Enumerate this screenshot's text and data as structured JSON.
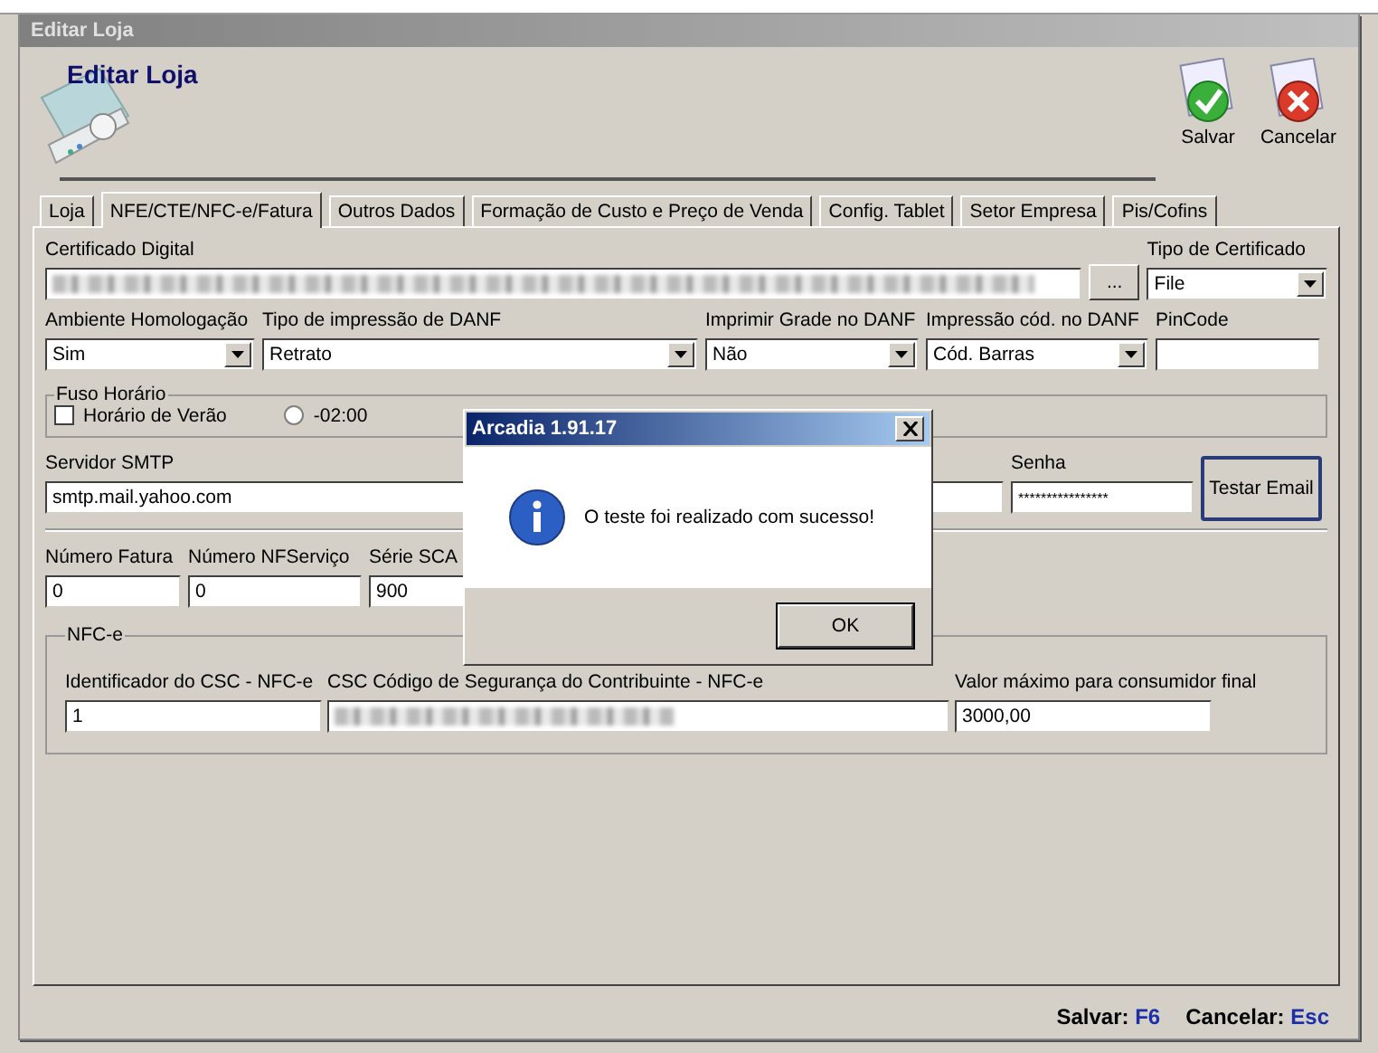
{
  "window": {
    "title": "Editar Loja"
  },
  "header": {
    "title": "Editar Loja"
  },
  "toolbar": [
    {
      "label": "Salvar",
      "kind": "save"
    },
    {
      "label": "Cancelar",
      "kind": "cancel"
    }
  ],
  "tabs": [
    {
      "label": "Loja",
      "selected": false
    },
    {
      "label": "NFE/CTE/NFC-e/Fatura",
      "selected": true
    },
    {
      "label": "Outros Dados",
      "selected": false
    },
    {
      "label": "Formação de Custo e Preço de Venda",
      "selected": false
    },
    {
      "label": "Config. Tablet",
      "selected": false
    },
    {
      "label": "Setor Empresa",
      "selected": false
    },
    {
      "label": "Pis/Cofins",
      "selected": false
    }
  ],
  "certificate": {
    "label": "Certificado Digital",
    "browse_button": "...",
    "type_label": "Tipo de Certificado",
    "type_value": "File"
  },
  "danf_row": [
    {
      "label": "Ambiente Homologação",
      "value": "Sim",
      "kind": "select"
    },
    {
      "label": "Tipo de impressão de DANF",
      "value": "Retrato",
      "kind": "select"
    },
    {
      "label": "Imprimir Grade no DANF",
      "value": "Não",
      "kind": "select"
    },
    {
      "label": "Impressão cód. no DANF",
      "value": "Cód. Barras",
      "kind": "select"
    },
    {
      "label": "PinCode",
      "kind": "text"
    }
  ],
  "timezone": {
    "legend": "Fuso Horário",
    "dst": {
      "label": "Horário de Verão",
      "checked": false
    },
    "offsets": [
      {
        "label": "-02:00",
        "selected": false
      }
    ]
  },
  "email": {
    "server_label": "Servidor SMTP",
    "server_value": "smtp.mail.yahoo.com",
    "password_label": "Senha",
    "password_value": "****************",
    "test_button": "Testar Email"
  },
  "numbers": [
    {
      "label": "Número Fatura",
      "value": "0"
    },
    {
      "label": "Número NFServiço",
      "value": "0"
    },
    {
      "label": "Série SCA",
      "value": "900"
    }
  ],
  "nfce": {
    "legend": "NFC-e",
    "fields": [
      {
        "label": "Identificador do CSC - NFC-e",
        "value": "1",
        "kind": "text"
      },
      {
        "label": "CSC Código de Segurança do Contribuinte - NFC-e",
        "kind": "hidden"
      },
      {
        "label": "Valor máximo para consumidor final",
        "value": "3000,00",
        "kind": "text"
      }
    ]
  },
  "shortcuts": [
    {
      "label": "Salvar:",
      "key": "F6"
    },
    {
      "label": "Cancelar:",
      "key": "Esc"
    }
  ],
  "dialog": {
    "title": "Arcadia 1.91.17",
    "message": "O teste foi realizado com sucesso!",
    "button": "OK"
  }
}
